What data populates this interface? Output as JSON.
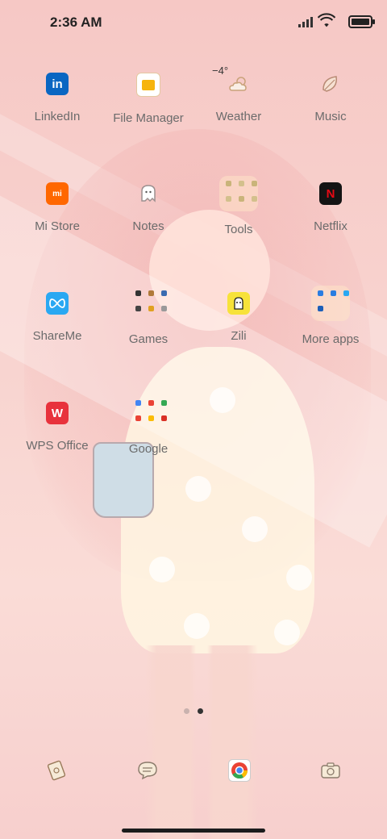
{
  "status": {
    "time": "2:36 AM"
  },
  "weather": {
    "temperature": "−4°"
  },
  "apps": [
    {
      "name": "LinkedIn"
    },
    {
      "name": "File Manager"
    },
    {
      "name": "Weather"
    },
    {
      "name": "Music"
    },
    {
      "name": "Mi Store"
    },
    {
      "name": "Notes"
    },
    {
      "name": "Tools"
    },
    {
      "name": "Netflix"
    },
    {
      "name": "ShareMe"
    },
    {
      "name": "Games"
    },
    {
      "name": "Zili"
    },
    {
      "name": "More apps"
    },
    {
      "name": "WPS Office"
    },
    {
      "name": "Google"
    }
  ],
  "icons": {
    "linkedin": "in",
    "mistore": "mi",
    "netflix": "N",
    "wps": "W"
  },
  "colors": {
    "linkedin": "#0a66c2",
    "filemanager": "#f6b40e",
    "mistore": "#ff6700",
    "netflix": "#e50914",
    "shareme": "#2aa8f2",
    "wps": "#e8323c",
    "zili": "#f7e23a"
  },
  "pages": {
    "count": 2,
    "active": 2
  }
}
